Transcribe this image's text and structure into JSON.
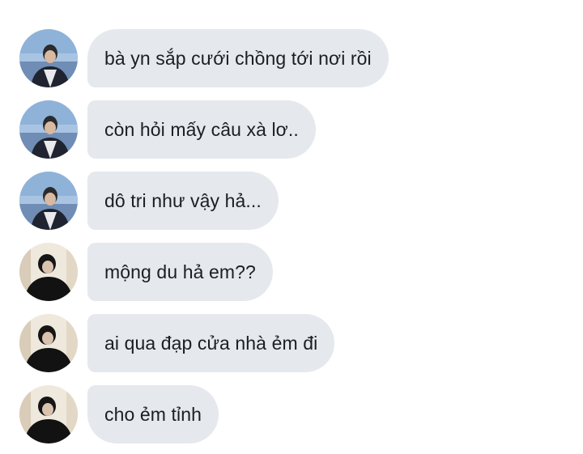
{
  "conversation": {
    "messages": [
      {
        "sender_avatar": "avatar-photo-blue-sky",
        "text": "bà yn sắp cưới chồng tới nơi rồi"
      },
      {
        "sender_avatar": "avatar-photo-blue-sky",
        "text": "còn hỏi mấy câu xà lơ.."
      },
      {
        "sender_avatar": "avatar-photo-blue-sky",
        "text": "dô tri như vậy hả..."
      },
      {
        "sender_avatar": "avatar-photo-dark-curtain",
        "text": "mộng du hả em??"
      },
      {
        "sender_avatar": "avatar-photo-dark-curtain",
        "text": "ai qua đạp cửa nhà ẻm đi"
      },
      {
        "sender_avatar": "avatar-photo-dark-curtain",
        "text": "cho ẻm tỉnh"
      }
    ]
  },
  "colors": {
    "bubble_background": "#e5e8ed",
    "text": "#1c1e21",
    "page_background": "#ffffff"
  }
}
